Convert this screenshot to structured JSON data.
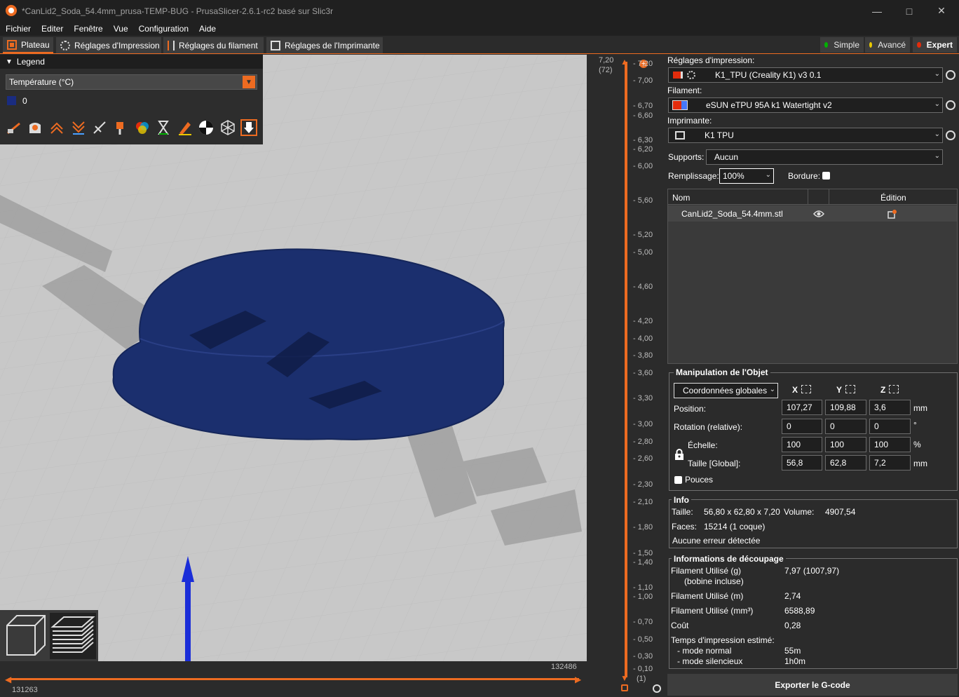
{
  "window": {
    "title": "*CanLid2_Soda_54.4mm_prusa-TEMP-BUG - PrusaSlicer-2.6.1-rc2 basé sur Slic3r"
  },
  "menu": [
    "Fichier",
    "Editer",
    "Fenêtre",
    "Vue",
    "Configuration",
    "Aide"
  ],
  "tabs": {
    "plateau": "Plateau",
    "print": "Réglages d'Impression",
    "filament": "Réglages du filament",
    "printer": "Réglages de l'Imprimante"
  },
  "modes": {
    "simple": "Simple",
    "advanced": "Avancé",
    "expert": "Expert"
  },
  "mode_colors": {
    "simple": "#00b000",
    "advanced": "#e8c800",
    "expert": "#e22c0c"
  },
  "legend": {
    "title": "Legend",
    "view_type": "Température (°C)",
    "entries": [
      {
        "color": "#1a2c80",
        "label": "0"
      }
    ]
  },
  "vslider": {
    "top_value": "7,20",
    "top_layer": "(72)",
    "bottom_layer": "(1)",
    "ticks": [
      "7,00",
      "6,70",
      "6,60",
      "6,30",
      "6,20",
      "6,00",
      "5,60",
      "5,20",
      "5,00",
      "4,60",
      "4,20",
      "4,00",
      "3,80",
      "3,60",
      "3,30",
      "3,00",
      "2,80",
      "2,60",
      "2,30",
      "2,10",
      "1,80",
      "1,50",
      "1,40",
      "1,10",
      "1,00",
      "0,70",
      "0,50",
      "0,30",
      "0,10"
    ],
    "tick_duplicate_top": "7,20"
  },
  "hslider": {
    "left_value": "131263",
    "right_value": "132486"
  },
  "settings": {
    "print_label": "Réglages d'impression:",
    "print_value": "K1_TPU (Creality K1) v3 0.1",
    "filament_label": "Filament:",
    "filament_value": "eSUN eTPU 95A k1 Watertight v2",
    "printer_label": "Imprimante:",
    "printer_value": "K1 TPU",
    "supports_label": "Supports:",
    "supports_value": "Aucun",
    "infill_label": "Remplissage:",
    "infill_value": "100%",
    "brim_label": "Bordure:"
  },
  "objects": {
    "col_name": "Nom",
    "col_edit": "Édition",
    "rows": [
      {
        "name": "CanLid2_Soda_54.4mm.stl"
      }
    ]
  },
  "manip": {
    "title": "Manipulation de l'Objet",
    "coords": "Coordonnées globales",
    "axes": [
      "X",
      "Y",
      "Z"
    ],
    "position_label": "Position:",
    "position": [
      "107,27",
      "109,88",
      "3,6"
    ],
    "position_unit": "mm",
    "rotation_label": "Rotation (relative):",
    "rotation": [
      "0",
      "0",
      "0"
    ],
    "rotation_unit": "°",
    "scale_label": "Échelle:",
    "scale": [
      "100",
      "100",
      "100"
    ],
    "scale_unit": "%",
    "size_label": "Taille [Global]:",
    "size": [
      "56,8",
      "62,8",
      "7,2"
    ],
    "size_unit": "mm",
    "inches_label": "Pouces"
  },
  "info": {
    "title": "Info",
    "size_label": "Taille:",
    "size_value": "56,80 x 62,80 x 7,20",
    "volume_label": "Volume:",
    "volume_value": "4907,54",
    "faces_label": "Faces:",
    "faces_value": "15214 (1 coque)",
    "errors": "Aucune erreur détectée"
  },
  "slice": {
    "title": "Informations de découpage",
    "fil_g_label": "Filament Utilisé (g)",
    "fil_g_sub": "(bobine incluse)",
    "fil_g_value": "7,97 (1007,97)",
    "fil_m_label": "Filament Utilisé (m)",
    "fil_m_value": "2,74",
    "fil_mm3_label": "Filament Utilisé (mm³)",
    "fil_mm3_value": "6588,89",
    "cost_label": "Coût",
    "cost_value": "0,28",
    "time_label": "Temps d'impression estimé:",
    "normal_label": "- mode normal",
    "normal_value": "55m",
    "silent_label": "- mode silencieux",
    "silent_value": "1h0m"
  },
  "export_label": "Exporter le G-code"
}
